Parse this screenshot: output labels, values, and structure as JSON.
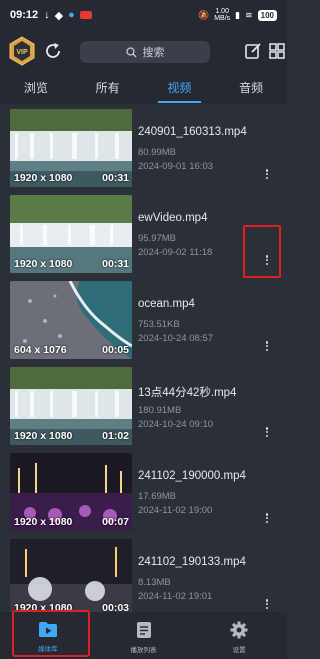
{
  "status_bar": {
    "time": "09:12",
    "net_speed": "1.00\nMB/s",
    "battery": "100"
  },
  "header": {
    "search_placeholder": "搜索"
  },
  "tabs": [
    {
      "label": "浏览",
      "active": false
    },
    {
      "label": "所有",
      "active": false
    },
    {
      "label": "视频",
      "active": true
    },
    {
      "label": "音频",
      "active": false
    }
  ],
  "videos": [
    {
      "name": "240901_160313.mp4",
      "size": "80.99MB",
      "date": "2024-09-01 16:03",
      "resolution": "1920 x 1080",
      "duration": "00:31",
      "thumb": "waterfall"
    },
    {
      "name": "ewVideo.mp4",
      "size": "95.97MB",
      "date": "2024-09-02 11:18",
      "resolution": "1920 x 1080",
      "duration": "00:31",
      "thumb": "waterfall2"
    },
    {
      "name": "ocean.mp4",
      "size": "753.51KB",
      "date": "2024-10-24 08:57",
      "resolution": "604 x 1076",
      "duration": "00:05",
      "thumb": "ocean"
    },
    {
      "name": "13点44分42秒.mp4",
      "size": "180.91MB",
      "date": "2024-10-24 09:10",
      "resolution": "1920 x 1080",
      "duration": "01:02",
      "thumb": "waterfall"
    },
    {
      "name": "241102_190000.mp4",
      "size": "17.69MB",
      "date": "2024-11-02 19:00",
      "resolution": "1920 x 1080",
      "duration": "00:07",
      "thumb": "concert"
    },
    {
      "name": "241102_190133.mp4",
      "size": "8.13MB",
      "date": "2024-11-02 19:01",
      "resolution": "1920 x 1080",
      "duration": "00:03",
      "thumb": "concert2"
    }
  ],
  "bottom_nav": [
    {
      "label": "媒体库",
      "icon": "play-folder-icon",
      "active": true
    },
    {
      "label": "播放列表",
      "icon": "document-list-icon",
      "active": false
    },
    {
      "label": "设置",
      "icon": "gear-icon",
      "active": false
    }
  ],
  "colors": {
    "accent": "#3fa9f5",
    "background": "#2b2f38",
    "highlight": "#e02020"
  }
}
